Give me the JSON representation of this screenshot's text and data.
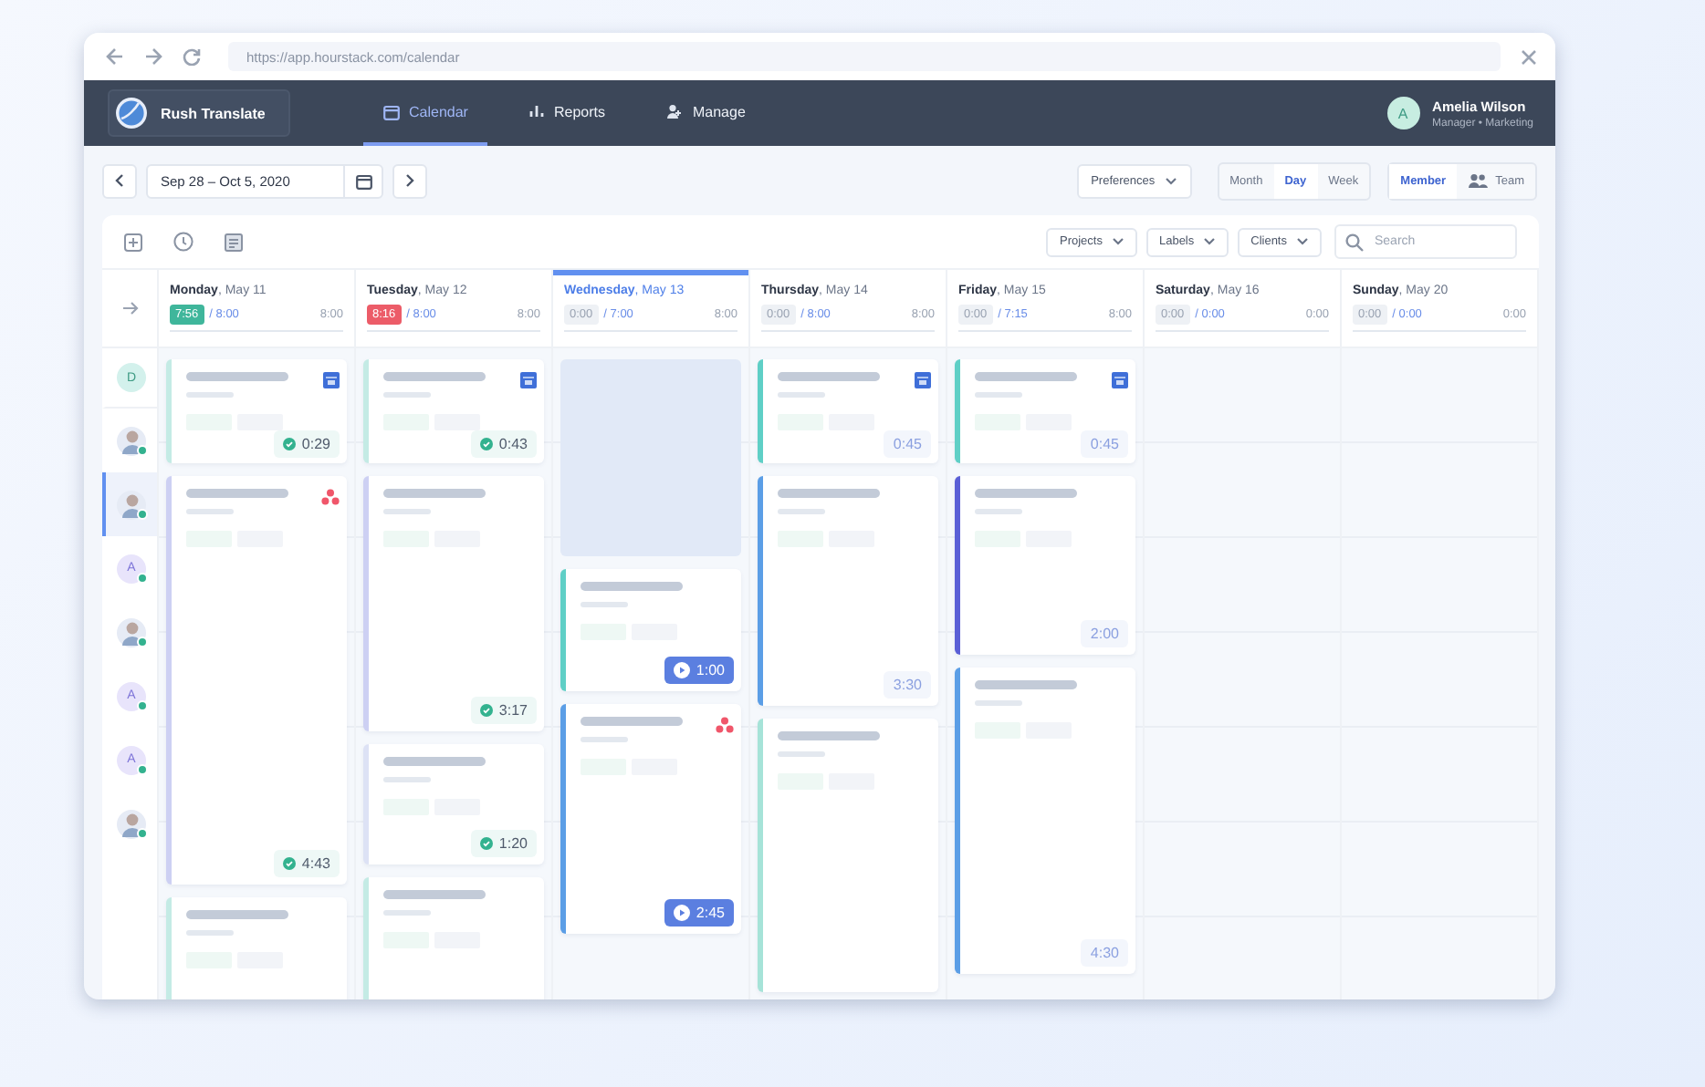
{
  "browser": {
    "url": "https://app.hourstack.com/calendar"
  },
  "nav": {
    "workspace": "Rush Translate",
    "tabs": [
      {
        "label": "Calendar",
        "selected": true
      },
      {
        "label": "Reports",
        "selected": false
      },
      {
        "label": "Manage",
        "selected": false
      }
    ],
    "user": {
      "initial": "A",
      "name": "Amelia Wilson",
      "role": "Manager • Marketing"
    }
  },
  "toolbar": {
    "date_range": "Sep 28 – Oct 5, 2020",
    "preferences": "Preferences",
    "views": [
      {
        "label": "Month",
        "selected": false
      },
      {
        "label": "Day",
        "selected": true
      },
      {
        "label": "Week",
        "selected": false
      }
    ],
    "modes": [
      {
        "label": "Member",
        "selected": true
      },
      {
        "label": "Team",
        "selected": false
      }
    ]
  },
  "filters": [
    {
      "label": "Projects"
    },
    {
      "label": "Labels"
    },
    {
      "label": "Clients"
    }
  ],
  "search": {
    "placeholder": "Search"
  },
  "members": [
    {
      "kind": "initial",
      "initial": "D",
      "online": false,
      "selected": false
    },
    {
      "kind": "photo",
      "online": true,
      "selected": false
    },
    {
      "kind": "photo",
      "online": true,
      "selected": true
    },
    {
      "kind": "initial",
      "initial": "A",
      "online": true,
      "selected": false
    },
    {
      "kind": "photo",
      "online": true,
      "selected": false
    },
    {
      "kind": "initial",
      "initial": "A",
      "online": true,
      "selected": false
    },
    {
      "kind": "initial",
      "initial": "A",
      "online": true,
      "selected": false
    },
    {
      "kind": "photo",
      "online": true,
      "selected": false
    }
  ],
  "days": [
    {
      "label": "**Monday**, May 11",
      "selected": false,
      "tracked": {
        "kind": "on_track",
        "text": "7:56"
      },
      "planned": "/ 8:00",
      "capacity": "8:00",
      "cards": [
        {
          "kind": "calendar_task",
          "color": "#c4ebe5",
          "duration": {
            "kind": "done",
            "text": "0:29"
          }
        },
        {
          "kind": "cluster_task",
          "color": "#cdd0f3",
          "duration": {
            "kind": "done",
            "text": "4:43"
          }
        },
        {
          "kind": "task",
          "color": "#c4ebe5"
        }
      ]
    },
    {
      "label": "**Tuesday**, May 12",
      "selected": false,
      "tracked": {
        "kind": "over",
        "text": "8:16"
      },
      "planned": "/ 8:00",
      "capacity": "8:00",
      "cards": [
        {
          "kind": "calendar_task",
          "color": "#c4ebe5",
          "duration": {
            "kind": "done",
            "text": "0:43"
          }
        },
        {
          "kind": "task",
          "color": "#cdd0f3",
          "duration": {
            "kind": "done",
            "text": "3:17"
          }
        },
        {
          "kind": "task",
          "color": "#dde2f5",
          "duration": {
            "kind": "done",
            "text": "1:20"
          }
        },
        {
          "kind": "task",
          "color": "#c4ebe5"
        }
      ]
    },
    {
      "label": "**Wednesday**, May 13",
      "selected": true,
      "tracked": {
        "kind": "empty",
        "text": "0:00"
      },
      "planned": "/ 7:00",
      "capacity": "8:00",
      "cards": [
        {
          "kind": "empty"
        },
        {
          "kind": "task",
          "color": "#5fcfc6",
          "duration": {
            "kind": "running",
            "text": "1:00"
          }
        },
        {
          "kind": "cluster_task",
          "color": "#5b9ee6",
          "duration": {
            "kind": "running",
            "text": "2:45"
          }
        }
      ]
    },
    {
      "label": "**Thursday**, May 14",
      "selected": false,
      "tracked": {
        "kind": "empty",
        "text": "0:00"
      },
      "planned": "/ 8:00",
      "capacity": "8:00",
      "cards": [
        {
          "kind": "calendar_task",
          "color": "#5fcfc6",
          "duration": {
            "kind": "plain",
            "text": "0:45"
          }
        },
        {
          "kind": "task",
          "color": "#5b9ee6",
          "duration": {
            "kind": "plain",
            "text": "3:30"
          }
        },
        {
          "kind": "task",
          "color": "#a6e3d8"
        }
      ]
    },
    {
      "label": "**Friday**, May 15",
      "selected": false,
      "tracked": {
        "kind": "empty",
        "text": "0:00"
      },
      "planned": "/ 7:15",
      "capacity": "8:00",
      "cards": [
        {
          "kind": "calendar_task",
          "color": "#5fcfc6",
          "duration": {
            "kind": "plain",
            "text": "0:45"
          }
        },
        {
          "kind": "task",
          "color": "#5a5fd6",
          "duration": {
            "kind": "plain",
            "text": "2:00"
          }
        },
        {
          "kind": "task",
          "color": "#5b9ee6",
          "duration": {
            "kind": "plain",
            "text": "4:30"
          }
        }
      ]
    },
    {
      "label": "**Saturday**, May 16",
      "selected": false,
      "tracked": {
        "kind": "empty",
        "text": "0:00"
      },
      "planned": "/ 0:00",
      "capacity": "0:00"
    },
    {
      "label": "**Sunday**, May 20",
      "selected": false,
      "tracked": {
        "kind": "empty",
        "text": "0:00"
      },
      "planned": "/ 0:00",
      "capacity": "0:00"
    }
  ]
}
